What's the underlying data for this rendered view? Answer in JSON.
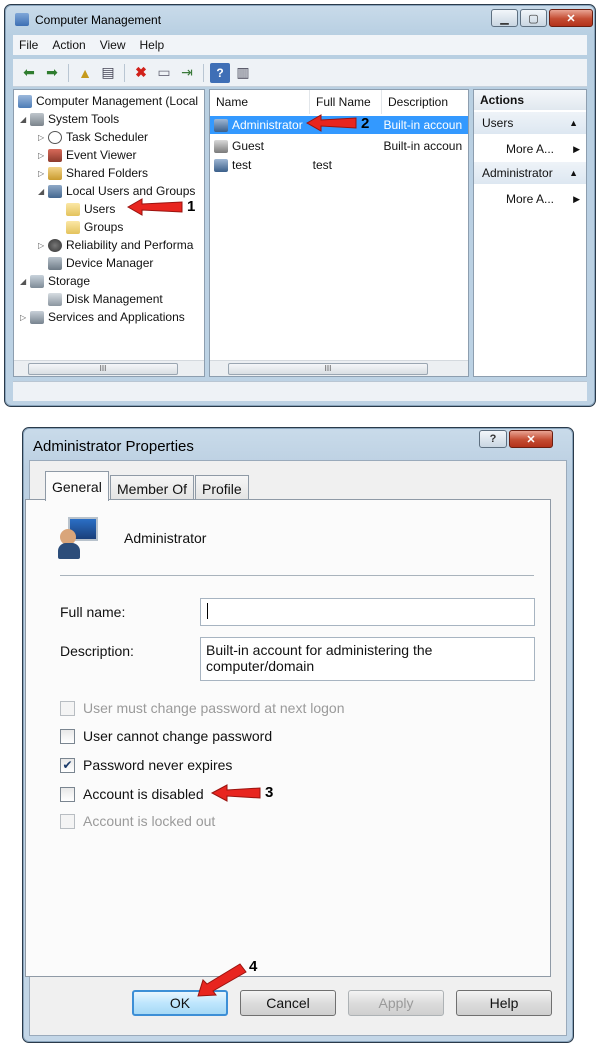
{
  "computer_management": {
    "title": "Computer Management",
    "menu": [
      "File",
      "Action",
      "View",
      "Help"
    ],
    "tree": [
      {
        "label": "Computer Management (Local",
        "icon": "computer-icon"
      },
      {
        "label": "System Tools",
        "icon": "tools-icon"
      },
      {
        "label": "Task Scheduler",
        "icon": "clock-icon"
      },
      {
        "label": "Event Viewer",
        "icon": "event-viewer-icon"
      },
      {
        "label": "Shared Folders",
        "icon": "shared-folder-icon"
      },
      {
        "label": "Local Users and Groups",
        "icon": "users-group-icon"
      },
      {
        "label": "Users",
        "icon": "folder-icon"
      },
      {
        "label": "Groups",
        "icon": "folder-icon"
      },
      {
        "label": "Reliability and Performa",
        "icon": "reliability-icon"
      },
      {
        "label": "Device Manager",
        "icon": "device-manager-icon"
      },
      {
        "label": "Storage",
        "icon": "storage-icon"
      },
      {
        "label": "Disk Management",
        "icon": "disk-icon"
      },
      {
        "label": "Services and Applications",
        "icon": "services-icon"
      }
    ],
    "list_columns": [
      "Name",
      "Full Name",
      "Description"
    ],
    "list_rows": [
      {
        "name": "Administrator",
        "full_name": "",
        "description": "Built-in accoun"
      },
      {
        "name": "Guest",
        "full_name": "",
        "description": "Built-in accoun"
      },
      {
        "name": "test",
        "full_name": "test",
        "description": ""
      }
    ],
    "actions": {
      "header": "Actions",
      "sections": [
        {
          "title": "Users",
          "item": "More A..."
        },
        {
          "title": "Administrator",
          "item": "More A..."
        }
      ]
    },
    "scroll_label": "III"
  },
  "properties_dialog": {
    "title": "Administrator Properties",
    "tabs": [
      "General",
      "Member Of",
      "Profile"
    ],
    "user_name": "Administrator",
    "full_name_label": "Full name:",
    "full_name_value": "",
    "description_label": "Description:",
    "description_value": "Built-in account for administering the computer/domain",
    "checkboxes": [
      {
        "label": "User must change password at next logon",
        "checked": false,
        "enabled": false
      },
      {
        "label": "User cannot change password",
        "checked": false,
        "enabled": true
      },
      {
        "label": "Password never expires",
        "checked": true,
        "enabled": true
      },
      {
        "label": "Account is disabled",
        "checked": false,
        "enabled": true
      },
      {
        "label": "Account is locked out",
        "checked": false,
        "enabled": false
      }
    ],
    "buttons": {
      "ok": "OK",
      "cancel": "Cancel",
      "apply": "Apply",
      "help": "Help"
    }
  },
  "step_markers": [
    "1",
    "2",
    "3",
    "4"
  ],
  "colors": {
    "selection": "#3399ff",
    "arrow": "#e8251f",
    "default_button_border": "#3d8fd6"
  }
}
